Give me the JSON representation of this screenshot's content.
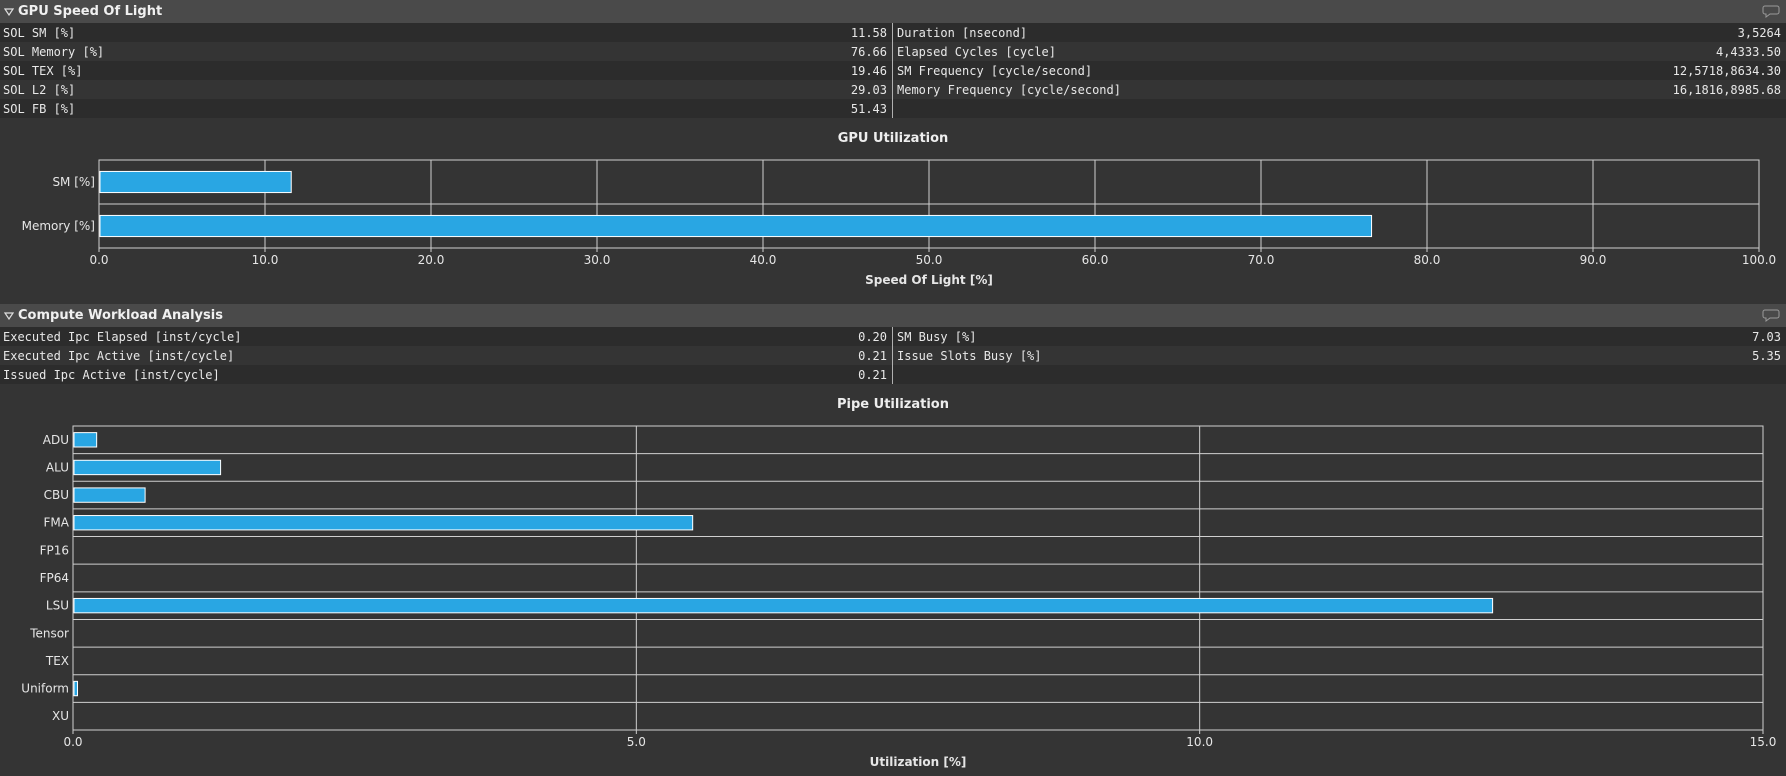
{
  "sections": [
    {
      "title": "GPU Speed Of Light",
      "left_metrics": [
        {
          "name": "SOL SM [%]",
          "value": "11.58"
        },
        {
          "name": "SOL Memory [%]",
          "value": "76.66"
        },
        {
          "name": "SOL TEX [%]",
          "value": "19.46"
        },
        {
          "name": "SOL L2 [%]",
          "value": "29.03"
        },
        {
          "name": "SOL FB [%]",
          "value": "51.43"
        }
      ],
      "right_metrics": [
        {
          "name": "Duration [nsecond]",
          "value": "3,5264"
        },
        {
          "name": "Elapsed Cycles [cycle]",
          "value": "4,4333.50"
        },
        {
          "name": "SM Frequency [cycle/second]",
          "value": "12,5718,8634.30"
        },
        {
          "name": "Memory Frequency [cycle/second]",
          "value": "16,1816,8985.68"
        }
      ]
    },
    {
      "title": "Compute Workload Analysis",
      "left_metrics": [
        {
          "name": "Executed Ipc Elapsed [inst/cycle]",
          "value": "0.20"
        },
        {
          "name": "Executed Ipc Active [inst/cycle]",
          "value": "0.21"
        },
        {
          "name": "Issued Ipc Active [inst/cycle]",
          "value": "0.21"
        }
      ],
      "right_metrics": [
        {
          "name": "SM Busy [%]",
          "value": "7.03"
        },
        {
          "name": "Issue Slots Busy [%]",
          "value": "5.35"
        }
      ]
    }
  ],
  "chart_data": [
    {
      "type": "bar",
      "orientation": "horizontal",
      "title": "GPU Utilization",
      "xlabel": "Speed Of Light [%]",
      "categories": [
        "SM [%]",
        "Memory [%]"
      ],
      "values": [
        11.58,
        76.66
      ],
      "xlim": [
        0,
        100
      ],
      "xticks": [
        "0.0",
        "10.0",
        "20.0",
        "30.0",
        "40.0",
        "50.0",
        "60.0",
        "70.0",
        "80.0",
        "90.0",
        "100.0"
      ],
      "grid": true,
      "bar_color": "#29a6e3"
    },
    {
      "type": "bar",
      "orientation": "horizontal",
      "title": "Pipe Utilization",
      "xlabel": "Utilization [%]",
      "categories": [
        "ADU",
        "ALU",
        "CBU",
        "FMA",
        "FP16",
        "FP64",
        "LSU",
        "Tensor",
        "TEX",
        "Uniform",
        "XU"
      ],
      "values": [
        0.21,
        1.31,
        0.64,
        5.5,
        0,
        0,
        12.6,
        0,
        0,
        0.04,
        0
      ],
      "xlim": [
        0,
        15
      ],
      "xticks": [
        "0.0",
        "5.0",
        "10.0",
        "15.0"
      ],
      "grid": true,
      "bar_color": "#29a6e3"
    }
  ],
  "icons": {
    "collapse": "triangle-down-icon",
    "comment": "speech-bubble-icon"
  }
}
